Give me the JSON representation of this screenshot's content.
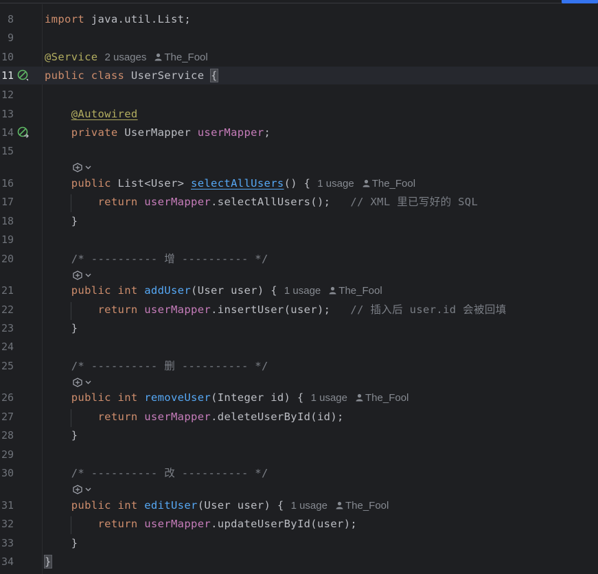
{
  "editor": {
    "scrollbar_color": "#3574f0",
    "lines": [
      {
        "n": "8",
        "code": "import java.util.List;"
      },
      {
        "n": "9",
        "code": ""
      },
      {
        "n": "10",
        "code": "@Service",
        "usages": "2 usages",
        "author": "The_Fool"
      },
      {
        "n": "11",
        "code": "public class UserService {",
        "gutter_icon": "bean-icon"
      },
      {
        "n": "12",
        "code": ""
      },
      {
        "n": "13",
        "code": "@Autowired"
      },
      {
        "n": "14",
        "code": "private UserMapper userMapper;",
        "gutter_icon": "bean-navigate-icon"
      },
      {
        "n": "15",
        "code": ""
      },
      {
        "n": "16",
        "code": "public List<User> selectAllUsers() {",
        "usages": "1 usage",
        "author": "The_Fool"
      },
      {
        "n": "17",
        "code": "return userMapper.selectAllUsers();",
        "comment": "// XML 里已写好的 SQL"
      },
      {
        "n": "18",
        "code": "}"
      },
      {
        "n": "19",
        "code": ""
      },
      {
        "n": "20",
        "code": "/* ---------- 增 ---------- */"
      },
      {
        "n": "21",
        "code": "public int addUser(User user) {",
        "usages": "1 usage",
        "author": "The_Fool"
      },
      {
        "n": "22",
        "code": "return userMapper.insertUser(user);",
        "comment": "// 插入后 user.id 会被回填"
      },
      {
        "n": "23",
        "code": "}"
      },
      {
        "n": "24",
        "code": ""
      },
      {
        "n": "25",
        "code": "/* ---------- 删 ---------- */"
      },
      {
        "n": "26",
        "code": "public int removeUser(Integer id) {",
        "usages": "1 usage",
        "author": "The_Fool"
      },
      {
        "n": "27",
        "code": "return userMapper.deleteUserById(id);"
      },
      {
        "n": "28",
        "code": "}"
      },
      {
        "n": "29",
        "code": ""
      },
      {
        "n": "30",
        "code": "/* ---------- 改 ---------- */"
      },
      {
        "n": "31",
        "code": "public int editUser(User user) {",
        "usages": "1 usage",
        "author": "The_Fool"
      },
      {
        "n": "32",
        "code": "return userMapper.updateUserById(user);"
      },
      {
        "n": "33",
        "code": "}"
      },
      {
        "n": "34",
        "code": "}"
      }
    ]
  },
  "t": {
    "l8a": "import",
    "l8b": " java.util.List;",
    "l10a": "@Service",
    "l11a": "public class ",
    "l11b": "UserService ",
    "l11c": "{",
    "l13a": "@Autowired",
    "l14a": "private ",
    "l14b": "UserMapper ",
    "l14c": "userMapper",
    "l14d": ";",
    "l16a": "public ",
    "l16b": "List<User> ",
    "l16c": "selectAllUsers",
    "l16d": "() {",
    "l17a": "return ",
    "l17b": "userMapper",
    ".": ".",
    "l17c": "selectAllUsers();",
    "l17d": "// XML 里已写好的 SQL",
    "l18a": "}",
    "l20a": "/* ---------- 增 ---------- */",
    "l21a": "public int ",
    "l21b": "addUser",
    "l21c": "(User user) {",
    "l22a": "return ",
    "l22b": "userMapper",
    "l22c": ".insertUser(user);",
    "l22d": "// 插入后 user.id 会被回填",
    "l23a": "}",
    "l25a": "/* ---------- 删 ---------- */",
    "l26a": "public int ",
    "l26b": "removeUser",
    "l26c": "(Integer id) {",
    "l27a": "return ",
    "l27b": "userMapper",
    "l27c": ".deleteUserById(id);",
    "l28a": "}",
    "l30a": "/* ---------- 改 ---------- */",
    "l31a": "public int ",
    "l31b": "editUser",
    "l31c": "(User user) {",
    "l32a": "return ",
    "l32b": "userMapper",
    "l32c": ".updateUserById(user);",
    "l33a": "}",
    "l34a": "}",
    "u2": "2 usages",
    "u1": "1 usage",
    "author": "The_Fool"
  }
}
